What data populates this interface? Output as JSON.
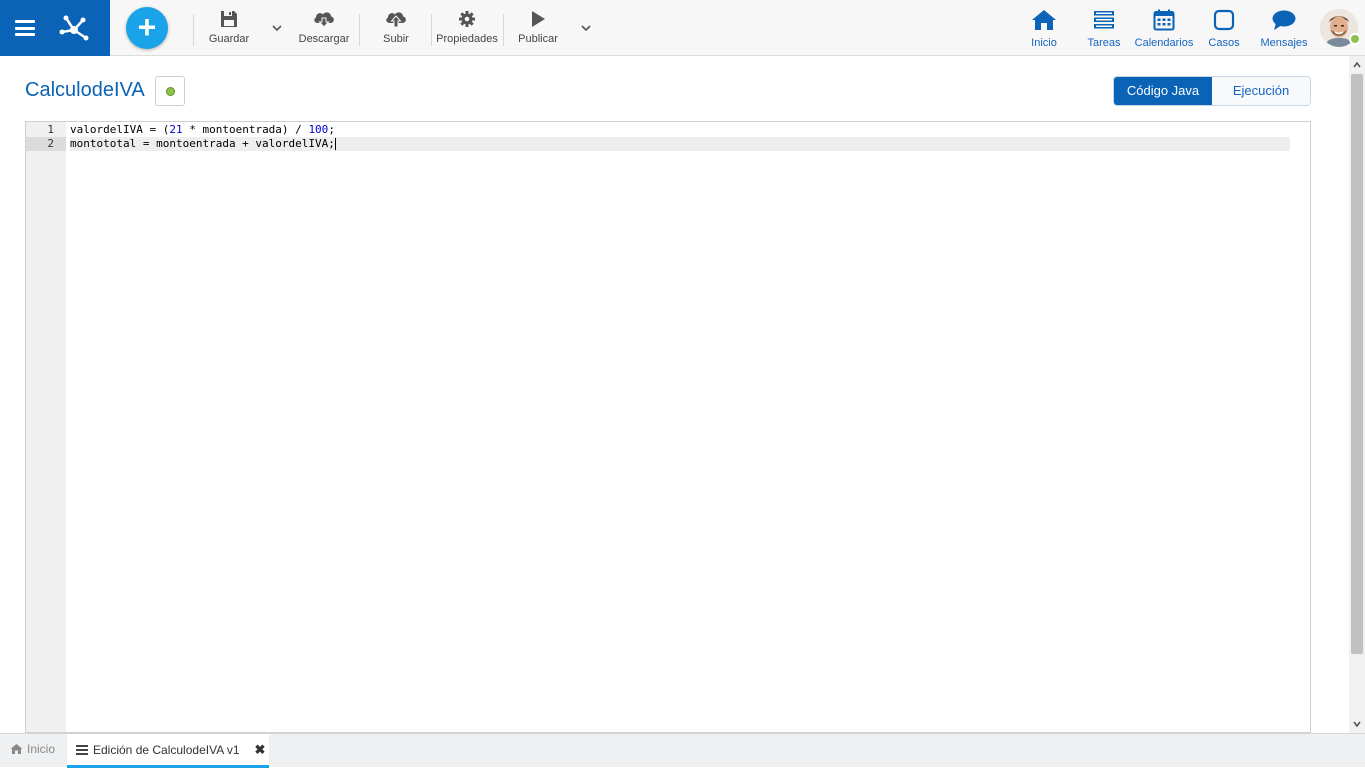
{
  "toolbar": {
    "save_label": "Guardar",
    "download_label": "Descargar",
    "upload_label": "Subir",
    "properties_label": "Propiedades",
    "publish_label": "Publicar"
  },
  "nav": {
    "home_label": "Inicio",
    "tasks_label": "Tareas",
    "calendars_label": "Calendarios",
    "cases_label": "Casos",
    "messages_label": "Mensajes"
  },
  "page": {
    "title": "CalculodeIVA",
    "status_color": "#8bc34a"
  },
  "view_toggle": {
    "java_label": "Código Java",
    "execution_label": "Ejecución",
    "selected": "java"
  },
  "editor": {
    "lines": [
      {
        "number": "1",
        "parts": [
          {
            "t": "valordelIVA = (",
            "k": "plain"
          },
          {
            "t": "21",
            "k": "num"
          },
          {
            "t": " * montoentrada) / ",
            "k": "plain"
          },
          {
            "t": "100",
            "k": "num"
          },
          {
            "t": ";",
            "k": "plain"
          }
        ]
      },
      {
        "number": "2",
        "parts": [
          {
            "t": "montototal = montoentrada + valordelIVA;",
            "k": "plain"
          }
        ]
      }
    ],
    "active_line": 2
  },
  "bottom_tabs": {
    "home_label": "Inicio",
    "edit_label": "Edición de CalculodeIVA v1"
  },
  "colors": {
    "brand": "#0a63b7",
    "accent": "#1aa3e8",
    "link": "#1565c0"
  }
}
